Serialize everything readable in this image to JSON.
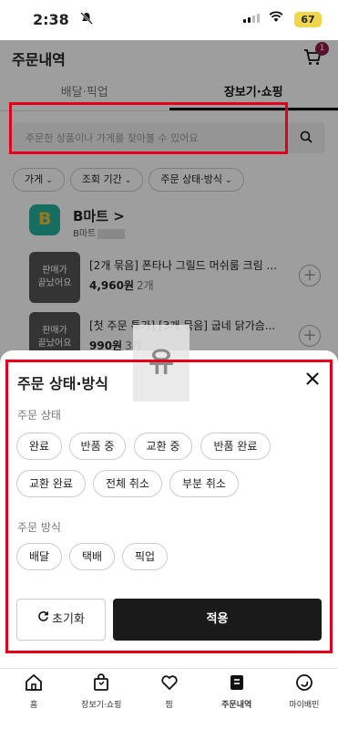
{
  "status_bar": {
    "time": "2:38",
    "battery": "67"
  },
  "header": {
    "title": "주문내역",
    "cart_badge": "1"
  },
  "tabs": [
    {
      "label": "배달·픽업"
    },
    {
      "label": "장보기·쇼핑"
    }
  ],
  "search": {
    "placeholder": "주문한 상품이나 가게를 찾아볼 수 있어요"
  },
  "filters": [
    {
      "label": "가게"
    },
    {
      "label": "조회 기간"
    },
    {
      "label": "주문 상태·방식"
    }
  ],
  "store": {
    "name": "B마트 >",
    "sub": "B마트"
  },
  "items": [
    {
      "thumb": "판매가\n끝났어요",
      "name": "[2개 묶음] 폰타나 그릴드 머쉬룸 크림 ...",
      "price": "4,960원",
      "qty": "2개"
    },
    {
      "thumb": "판매가\n끝났어요",
      "name": "[첫 주문 특가] [3개 묶음] 굽네 닭가슴...",
      "price": "990원",
      "qty": "3개"
    }
  ],
  "watermark": "유",
  "sheet": {
    "title": "주문 상태·방식",
    "status_label": "주문 상태",
    "status_options": [
      "완료",
      "반품 중",
      "교환 중",
      "반품 완료",
      "교환 완료",
      "전체 취소",
      "부분 취소"
    ],
    "method_label": "주문 방식",
    "method_options": [
      "배달",
      "택배",
      "픽업"
    ],
    "reset_label": "초기화",
    "apply_label": "적용"
  },
  "nav": [
    {
      "label": "홈",
      "icon": "home-icon"
    },
    {
      "label": "장보기·쇼핑",
      "icon": "shopping-bag-icon"
    },
    {
      "label": "찜",
      "icon": "heart-icon"
    },
    {
      "label": "주문내역",
      "icon": "receipt-icon"
    },
    {
      "label": "마이배민",
      "icon": "smile-icon"
    }
  ]
}
